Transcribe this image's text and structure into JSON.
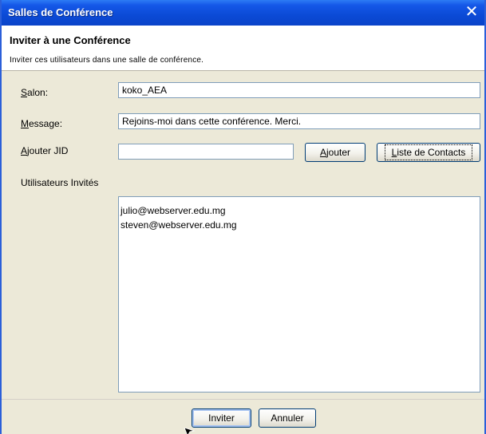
{
  "window": {
    "title": "Salles de Conférence",
    "close_glyph": "✕"
  },
  "header": {
    "title": "Inviter à une Conférence",
    "description": "Inviter ces utilisateurs dans une salle de conférence."
  },
  "form": {
    "room": {
      "label_mnemonic": "S",
      "label_rest": "alon:",
      "value": "koko_AEA"
    },
    "message": {
      "label_mnemonic": "M",
      "label_rest": "essage:",
      "value": "Rejoins-moi dans cette conférence. Merci."
    },
    "add_jid": {
      "label_mnemonic": "A",
      "label_rest": "jouter JID",
      "value": ""
    },
    "add_button": {
      "mnemonic": "A",
      "rest": "jouter"
    },
    "contacts_button": {
      "mnemonic": "L",
      "rest": "iste de Contacts"
    },
    "invited_label": "Utilisateurs Invités",
    "invited_users": [
      "julio@webserver.edu.mg",
      "steven@webserver.edu.mg"
    ]
  },
  "footer": {
    "invite_label": "Inviter",
    "cancel_label": "Annuler"
  },
  "icons": {
    "close": "close-icon",
    "cursor": "mouse-cursor-icon"
  },
  "colors": {
    "titlebar": "#0b4ad6",
    "window_bg": "#ece9d8",
    "field_border": "#7f9db9"
  }
}
